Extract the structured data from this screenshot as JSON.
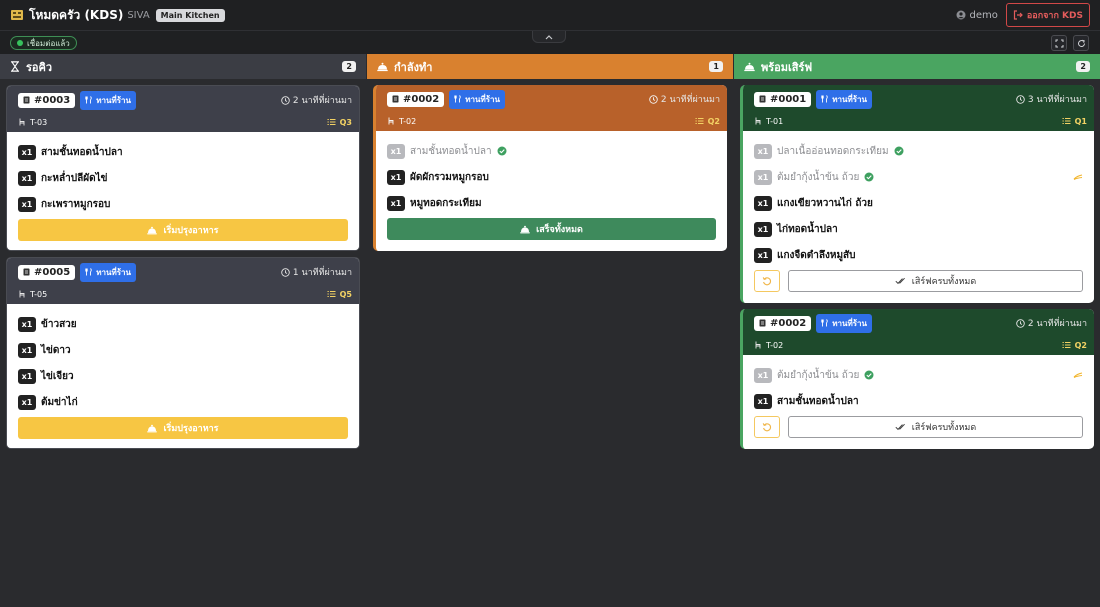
{
  "header": {
    "title": "โหมดครัว (KDS)",
    "subtitle": "SIVA",
    "kitchen": "Main Kitchen",
    "user": "demo",
    "logout_label": "ออกจาก KDS"
  },
  "status": {
    "connection_label": "เชื่อมต่อแล้ว"
  },
  "columns": [
    {
      "title": "รอคิว",
      "count": "2",
      "cards": [
        {
          "order": "#0003",
          "type": "ทานที่ร้าน",
          "elapsed": "2 นาทีที่ผ่านมา",
          "table": "T-03",
          "queue": "Q3",
          "items": [
            {
              "qty": "x1",
              "name": "สามชั้นทอดน้ำปลา"
            },
            {
              "qty": "x1",
              "name": "กะหล่ำปลีผัดไข่"
            },
            {
              "qty": "x1",
              "name": "กะเพราหมูกรอบ"
            }
          ],
          "action": "เริ่มปรุงอาหาร"
        },
        {
          "order": "#0005",
          "type": "ทานที่ร้าน",
          "elapsed": "1 นาทีที่ผ่านมา",
          "table": "T-05",
          "queue": "Q5",
          "items": [
            {
              "qty": "x1",
              "name": "ข้าวสวย"
            },
            {
              "qty": "x1",
              "name": "ไข่ดาว"
            },
            {
              "qty": "x1",
              "name": "ไข่เจียว"
            },
            {
              "qty": "x1",
              "name": "ต้มข่าไก่"
            }
          ],
          "action": "เริ่มปรุงอาหาร"
        }
      ]
    },
    {
      "title": "กำลังทำ",
      "count": "1",
      "cards": [
        {
          "order": "#0002",
          "type": "ทานที่ร้าน",
          "elapsed": "2 นาทีที่ผ่านมา",
          "table": "T-02",
          "queue": "Q2",
          "items": [
            {
              "qty": "x1",
              "name": "สามชั้นทอดน้ำปลา"
            },
            {
              "qty": "x1",
              "name": "ผัดผักรวมหมูกรอบ"
            },
            {
              "qty": "x1",
              "name": "หมูทอดกระเทียม"
            }
          ],
          "action": "เสร็จทั้งหมด"
        }
      ]
    },
    {
      "title": "พร้อมเสิร์ฟ",
      "count": "2",
      "cards": [
        {
          "order": "#0001",
          "type": "ทานที่ร้าน",
          "elapsed": "3 นาทีที่ผ่านมา",
          "table": "T-01",
          "queue": "Q1",
          "items": [
            {
              "qty": "x1",
              "name": "ปลาเนื้ออ่อนทอดกระเทียม"
            },
            {
              "qty": "x1",
              "name": "ต้มยำกุ้งน้ำข้น ถ้วย"
            },
            {
              "qty": "x1",
              "name": "แกงเขียวหวานไก่ ถ้วย"
            },
            {
              "qty": "x1",
              "name": "ไก่ทอดน้ำปลา"
            },
            {
              "qty": "x1",
              "name": "แกงจืดตำลึงหมูสับ"
            }
          ],
          "action": "เสิร์ฟครบทั้งหมด"
        },
        {
          "order": "#0002",
          "type": "ทานที่ร้าน",
          "elapsed": "2 นาทีที่ผ่านมา",
          "table": "T-02",
          "queue": "Q2",
          "items": [
            {
              "qty": "x1",
              "name": "ต้มยำกุ้งน้ำข้น ถ้วย"
            },
            {
              "qty": "x1",
              "name": "สามชั้นทอดน้ำปลา"
            }
          ],
          "action": "เสิร์ฟครบทั้งหมด"
        }
      ]
    }
  ],
  "colors": {
    "queue": "#3b3d44",
    "cooking": "#d9812f",
    "ready": "#4aa561",
    "dine_in": "#2f6fe8",
    "start_btn": "#f7c643",
    "done_btn": "#3e8a5c"
  }
}
